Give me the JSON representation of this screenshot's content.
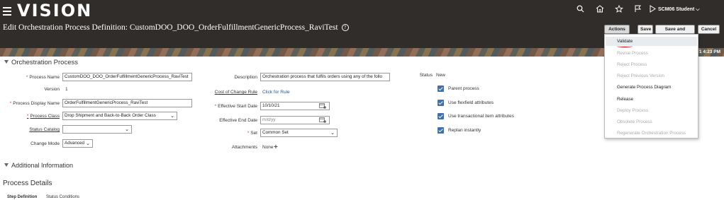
{
  "app": {
    "brand": "VISION",
    "user": "SCM06 Student",
    "icons": [
      "search-icon",
      "home-icon",
      "star-icon",
      "flag-icon",
      "notifications-icon"
    ]
  },
  "page": {
    "title": "Edit Orchestration Process Definition: CustomDOO_DOO_OrderFulfillmentGenericProcess_RaviTest",
    "help_glyph": "?",
    "time_fragment": "1 4:23 PM"
  },
  "toolbar": {
    "actions_label": "Actions",
    "save_label": "Save",
    "save_close_label": "Save and Close",
    "cancel_label": "Cancel"
  },
  "actions_menu": {
    "items": [
      {
        "label": "Validate",
        "enabled": true
      },
      {
        "label": "Revise Process",
        "enabled": false
      },
      {
        "label": "Reject Process",
        "enabled": false
      },
      {
        "label": "Reject Previous Version",
        "enabled": false
      },
      {
        "label": "Generate Process Diagram",
        "enabled": true
      },
      {
        "label": "Release",
        "enabled": true
      },
      {
        "label": "Deploy Process",
        "enabled": false
      },
      {
        "label": "Obsolete Process",
        "enabled": false
      },
      {
        "label": "Regenerate Orchestration Process",
        "enabled": false
      }
    ]
  },
  "orchestration": {
    "heading": "Orchestration Process",
    "process_name_label": "Process Name",
    "process_name_value": "CustomDOO_DOO_OrderFulfillmentGenericProcess_RaviTest",
    "version_label": "Version",
    "version_value": "1",
    "display_name_label": "Process Display Name",
    "display_name_value": "OrderFulfillmentGenericProcess_RaviTest",
    "process_class_label": "Process Class",
    "process_class_value": "Drop Shipment and Back-to-Back Order Class",
    "status_catalog_label": "Status Catalog",
    "status_catalog_value": "",
    "change_mode_label": "Change Mode",
    "change_mode_value": "Advanced",
    "description_label": "Description",
    "description_value": "Orchestration process that fulfils orders using any of the follo",
    "cost_rule_label": "Cost of Change Rule",
    "cost_rule_link": "Click for Rule",
    "start_date_label": "Effective Start Date",
    "start_date_value": "10/10/21",
    "end_date_label": "Effective End Date",
    "end_date_placeholder": "m/d/yy",
    "set_label": "Set",
    "set_value": "Common Set",
    "attachments_label": "Attachments",
    "attachments_value": "None",
    "status_label": "Status",
    "status_value": "New",
    "checkboxes": [
      {
        "label": "Parent process",
        "checked": true
      },
      {
        "label": "Use flexfield attributes",
        "checked": true
      },
      {
        "label": "Use transactional item attributes",
        "checked": true
      },
      {
        "label": "Replan instantly",
        "checked": true
      }
    ]
  },
  "additional": {
    "heading": "Additional Information"
  },
  "details": {
    "heading": "Process Details",
    "tabs": [
      "Step Definition",
      "Status Conditions"
    ]
  },
  "colors": {
    "header": "#312d2a",
    "link": "#1a5a96",
    "checkbox": "#3f6fb4",
    "required": "#c74634"
  }
}
